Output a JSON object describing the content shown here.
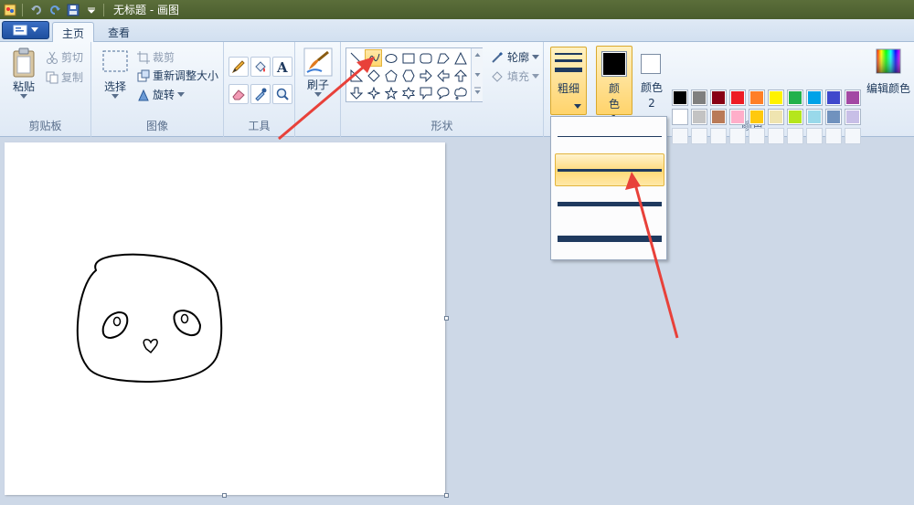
{
  "window": {
    "title": "无标题 - 画图"
  },
  "tabs": [
    {
      "label": "主页",
      "active": true
    },
    {
      "label": "查看",
      "active": false
    }
  ],
  "clipboard": {
    "paste_label": "粘贴",
    "cut_label": "剪切",
    "copy_label": "复制",
    "group_label": "剪贴板"
  },
  "image": {
    "select_label": "选择",
    "crop_label": "裁剪",
    "resize_label": "重新调整大小",
    "rotate_label": "旋转",
    "group_label": "图像"
  },
  "tools": {
    "group_label": "工具",
    "items": [
      "pencil-icon",
      "fill-icon",
      "text-icon",
      "eraser-icon",
      "color-picker-icon",
      "magnifier-icon"
    ]
  },
  "brushes": {
    "label": "刷子"
  },
  "shapes": {
    "group_label": "形状",
    "outline_label": "轮廓",
    "fill_label": "填充",
    "selected": "curve"
  },
  "size": {
    "label": "粗细",
    "options": [
      "1px",
      "3px",
      "5px",
      "8px"
    ],
    "hovered_index": 1
  },
  "colors": {
    "color1_label": "颜色 1",
    "color2_label": "颜色 2",
    "color1": "#000000",
    "color2": "#ffffff",
    "group_label": "颜色",
    "edit_label": "编辑颜色",
    "palette_row1": [
      "#000000",
      "#7f7f7f",
      "#880015",
      "#ed1c24",
      "#ff7f27",
      "#fff200",
      "#22b14c",
      "#00a2e8",
      "#3f48cc",
      "#a349a4"
    ],
    "palette_row2": [
      "#ffffff",
      "#c3c3c3",
      "#b97a57",
      "#ffaec9",
      "#ffc90e",
      "#efe4b0",
      "#b5e61d",
      "#99d9ea",
      "#7092be",
      "#c8bfe7"
    ]
  },
  "annotation": {
    "arrow_color": "#e8413a"
  }
}
